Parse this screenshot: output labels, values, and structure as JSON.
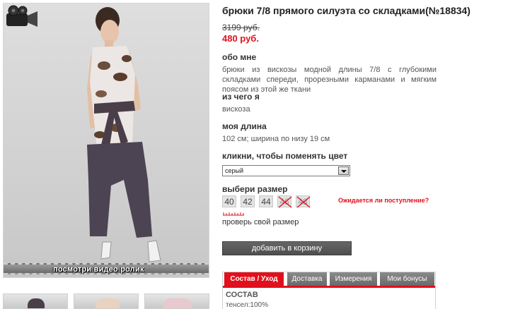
{
  "product": {
    "title": "брюки 7/8 прямого силуэта со складками(№18834)",
    "old_price": "3199 руб.",
    "new_price": "480 руб."
  },
  "sections": {
    "about": {
      "heading": "обо мне",
      "text": "брюки из вискозы модной длины 7/8 с глубокими складками спереди, прорезными карманами и мягким поясом из этой же ткани"
    },
    "material": {
      "heading": "из чего я",
      "text": "вискоза"
    },
    "length": {
      "heading": "моя длина",
      "text": "102 см; ширина по низу 19 см"
    }
  },
  "color": {
    "heading": "кликни, чтобы поменять цвет",
    "selected": "серый"
  },
  "size": {
    "heading": "выбери размер",
    "options": [
      {
        "label": "40",
        "available": true
      },
      {
        "label": "42",
        "available": true
      },
      {
        "label": "44",
        "available": true
      },
      {
        "label": "46",
        "available": false
      },
      {
        "label": "48",
        "available": false
      }
    ],
    "awaiting_link": "Ожидается ли поступление?",
    "check_link": "проверь свой размер"
  },
  "cart_button": "добавить в корзину",
  "photo": {
    "video_label": "посмотри видео ролик"
  },
  "tabs": {
    "items": [
      {
        "label": "Состав / Уход",
        "active": true
      },
      {
        "label": "Доставка",
        "active": false
      },
      {
        "label": "Измерения",
        "active": false
      },
      {
        "label": "Мои бонусы",
        "active": false
      }
    ],
    "body_heading": "СОСТАВ",
    "body_text": "тенсел:100%"
  },
  "colors": {
    "accent": "#e0101d",
    "button": "#555555",
    "tab": "#7a7a7a"
  }
}
